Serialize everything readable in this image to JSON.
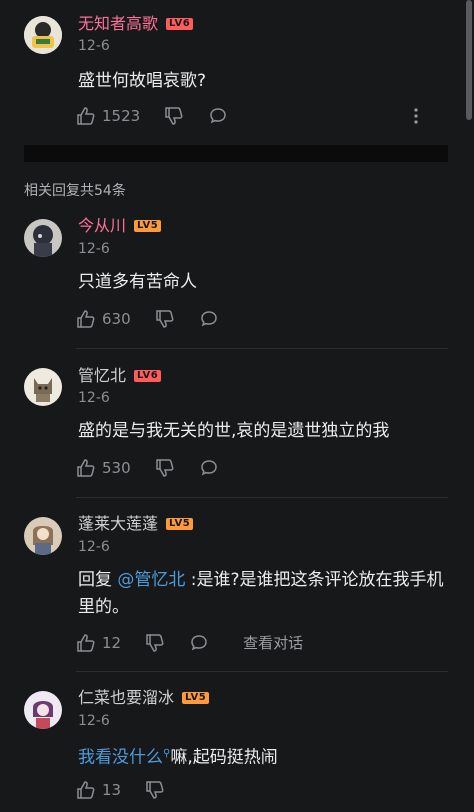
{
  "main_comment": {
    "username": "无知者高歌",
    "level": "LV6",
    "date": "12-6",
    "content": "盛世何故唱哀歌?",
    "likes": "1523"
  },
  "replies_header": "相关回复共54条",
  "replies": [
    {
      "username": "今从川",
      "level": "LV5",
      "date": "12-6",
      "content": "只道多有苦命人",
      "likes": "630"
    },
    {
      "username": "管忆北",
      "level": "LV6",
      "date": "12-6",
      "content": "盛的是与我无关的世,哀的是遗世独立的我",
      "likes": "530"
    },
    {
      "username": "蓬莱大莲蓬",
      "level": "LV5",
      "date": "12-6",
      "reply_prefix": "回复 ",
      "mention": "@管忆北",
      "content": " :是谁?是谁把这条评论放在我手机里的。",
      "likes": "12",
      "view_conversation": "查看对话"
    },
    {
      "username": "仁菜也要溜冰",
      "level": "LV5",
      "date": "12-6",
      "content_link": "我看没什么",
      "content": "嘛,起码挺热闹",
      "likes": "13"
    }
  ],
  "colors": {
    "background": "#17181a",
    "username_highlight": "#fb7299",
    "mention": "#4e9bdc",
    "lv6": "#ff5c5c",
    "lv5": "#ff9a3c"
  },
  "icons": [
    "thumb-up-icon",
    "thumb-down-icon",
    "comment-bubble-icon",
    "more-vertical-icon",
    "search-icon"
  ]
}
